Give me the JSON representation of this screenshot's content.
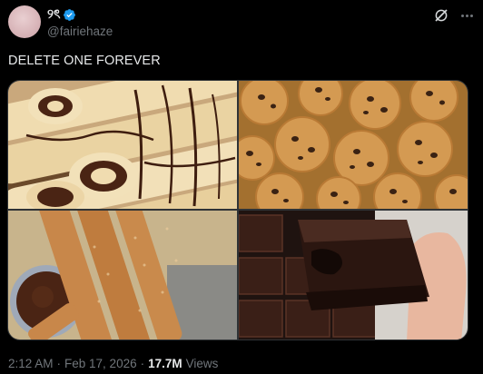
{
  "author": {
    "display_name": "୨ৎ",
    "handle": "@fairiehaze",
    "verified": true,
    "verified_color": "#1d9bf0",
    "avatar_color": "#d8b4b8"
  },
  "icons": {
    "grok": "grok-icon",
    "more": "more-icon",
    "verified": "verified-badge-icon"
  },
  "tweet": {
    "text": "DELETE ONE FOREVER"
  },
  "media": [
    {
      "name": "crepes-nutella-photo",
      "subject": "crepes with chocolate"
    },
    {
      "name": "chocolate-chip-cookies-photo",
      "subject": "chocolate chip cookies"
    },
    {
      "name": "churros-photo",
      "subject": "churros with chocolate dip"
    },
    {
      "name": "brownies-photo",
      "subject": "brownies"
    }
  ],
  "meta": {
    "time": "2:12 AM",
    "separator": "·",
    "date": "Feb 17, 2026",
    "views_count": "17.7M",
    "views_label": "Views"
  }
}
